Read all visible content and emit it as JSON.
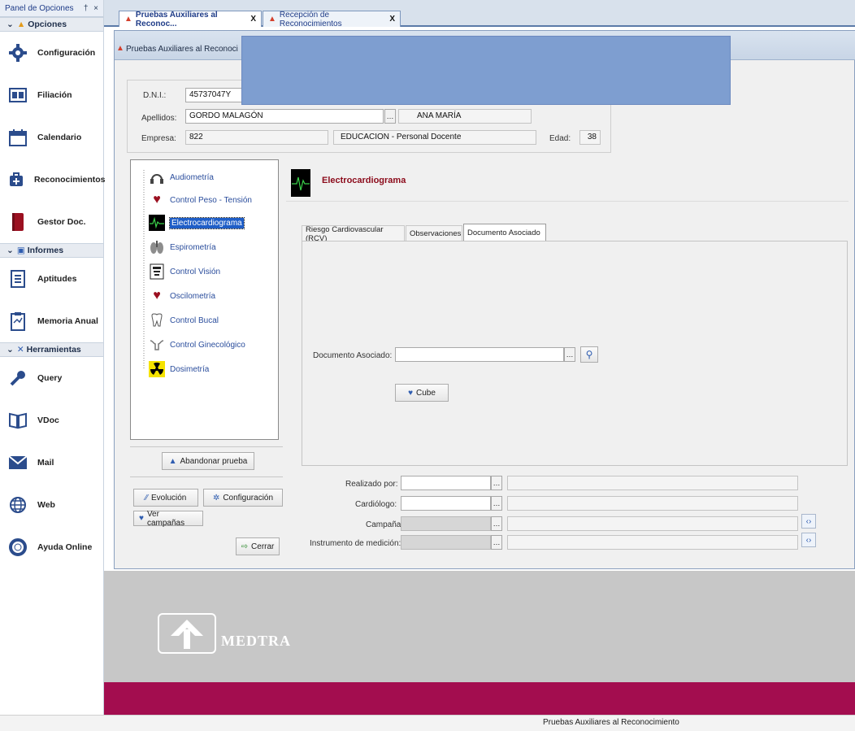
{
  "left_panel": {
    "title": "Panel de Opciones",
    "pin": "†",
    "close": "×",
    "sections": [
      {
        "label": "Opciones"
      },
      {
        "label": "Informes"
      },
      {
        "label": "Herramientas"
      }
    ],
    "opciones_items": [
      {
        "label": "Configuración",
        "icon": "gear-icon"
      },
      {
        "label": "Filiación",
        "icon": "id-card-icon"
      },
      {
        "label": "Calendario",
        "icon": "calendar-icon"
      },
      {
        "label": "Reconocimientos",
        "icon": "medkit-icon"
      },
      {
        "label": "Gestor Doc.",
        "icon": "book-icon"
      }
    ],
    "informes_items": [
      {
        "label": "Aptitudes",
        "icon": "document-icon"
      },
      {
        "label": "Memoria Anual",
        "icon": "clipboard-icon"
      }
    ],
    "herramientas_items": [
      {
        "label": "Query",
        "icon": "query-icon"
      },
      {
        "label": "VDoc",
        "icon": "vdoc-icon"
      },
      {
        "label": "Mail",
        "icon": "mail-icon"
      },
      {
        "label": "Web",
        "icon": "globe-icon"
      },
      {
        "label": "Ayuda Online",
        "icon": "lifebuoy-icon"
      }
    ]
  },
  "doc_tabs": [
    {
      "label": "Pruebas Auxiliares al Reconoc...",
      "close": "X"
    },
    {
      "label": "Recepción de Reconocimientos",
      "close": "X"
    }
  ],
  "window": {
    "title": "Pruebas Auxiliares al Reconoci"
  },
  "patient": {
    "dni_label": "D.N.I.:",
    "dni_value": "45737047Y",
    "apellidos_label": "Apellidos:",
    "apellidos_value": "GORDO MALAGÓN",
    "nombre_value": "ANA MARÍA",
    "empresa_label": "Empresa:",
    "empresa_code": "822",
    "empresa_desc": "EDUCACION - Personal Docente",
    "edad_label": "Edad:",
    "edad_value": "38"
  },
  "tests": [
    {
      "label": "Audiometría",
      "icon": "headphones-icon"
    },
    {
      "label": "Control Peso - Tensión",
      "icon": "heart-icon"
    },
    {
      "label": "Electrocardiograma",
      "icon": "ecg-icon",
      "selected": true
    },
    {
      "label": "Espirometría",
      "icon": "lungs-icon"
    },
    {
      "label": "Control Visión",
      "icon": "eye-chart-icon"
    },
    {
      "label": "Oscilometría",
      "icon": "heart-icon"
    },
    {
      "label": "Control Bucal",
      "icon": "tooth-icon"
    },
    {
      "label": "Control Ginecológico",
      "icon": "uterus-icon"
    },
    {
      "label": "Dosimetría",
      "icon": "radiation-icon"
    }
  ],
  "left_buttons": {
    "abandonar": "Abandonar prueba",
    "evolucion": "Evolución",
    "configuracion": "Configuración",
    "ver_campanas": "Ver campañas",
    "cerrar": "Cerrar"
  },
  "detail": {
    "title": "Electrocardiograma",
    "tabs": [
      {
        "label": "Riesgo Cardiovascular (RCV)"
      },
      {
        "label": "Observaciones"
      },
      {
        "label": "Documento Asociado",
        "active": true
      }
    ],
    "documento_label": "Documento Asociado:",
    "documento_value": "",
    "cube_button": "Cube",
    "realizado_label": "Realizado por:",
    "cardiologo_label": "Cardiólogo:",
    "campana_label": "Campaña:",
    "instrumento_label": "Instrumento de medición:"
  },
  "logo": {
    "text": "MEDTRA"
  },
  "status": {
    "text": "Pruebas Auxiliares al Reconocimiento"
  },
  "colors": {
    "accent": "#2f5db0",
    "brand_bar": "#a30d4f",
    "title_red": "#8b0a1a",
    "overlay": "#7e9ed0"
  }
}
